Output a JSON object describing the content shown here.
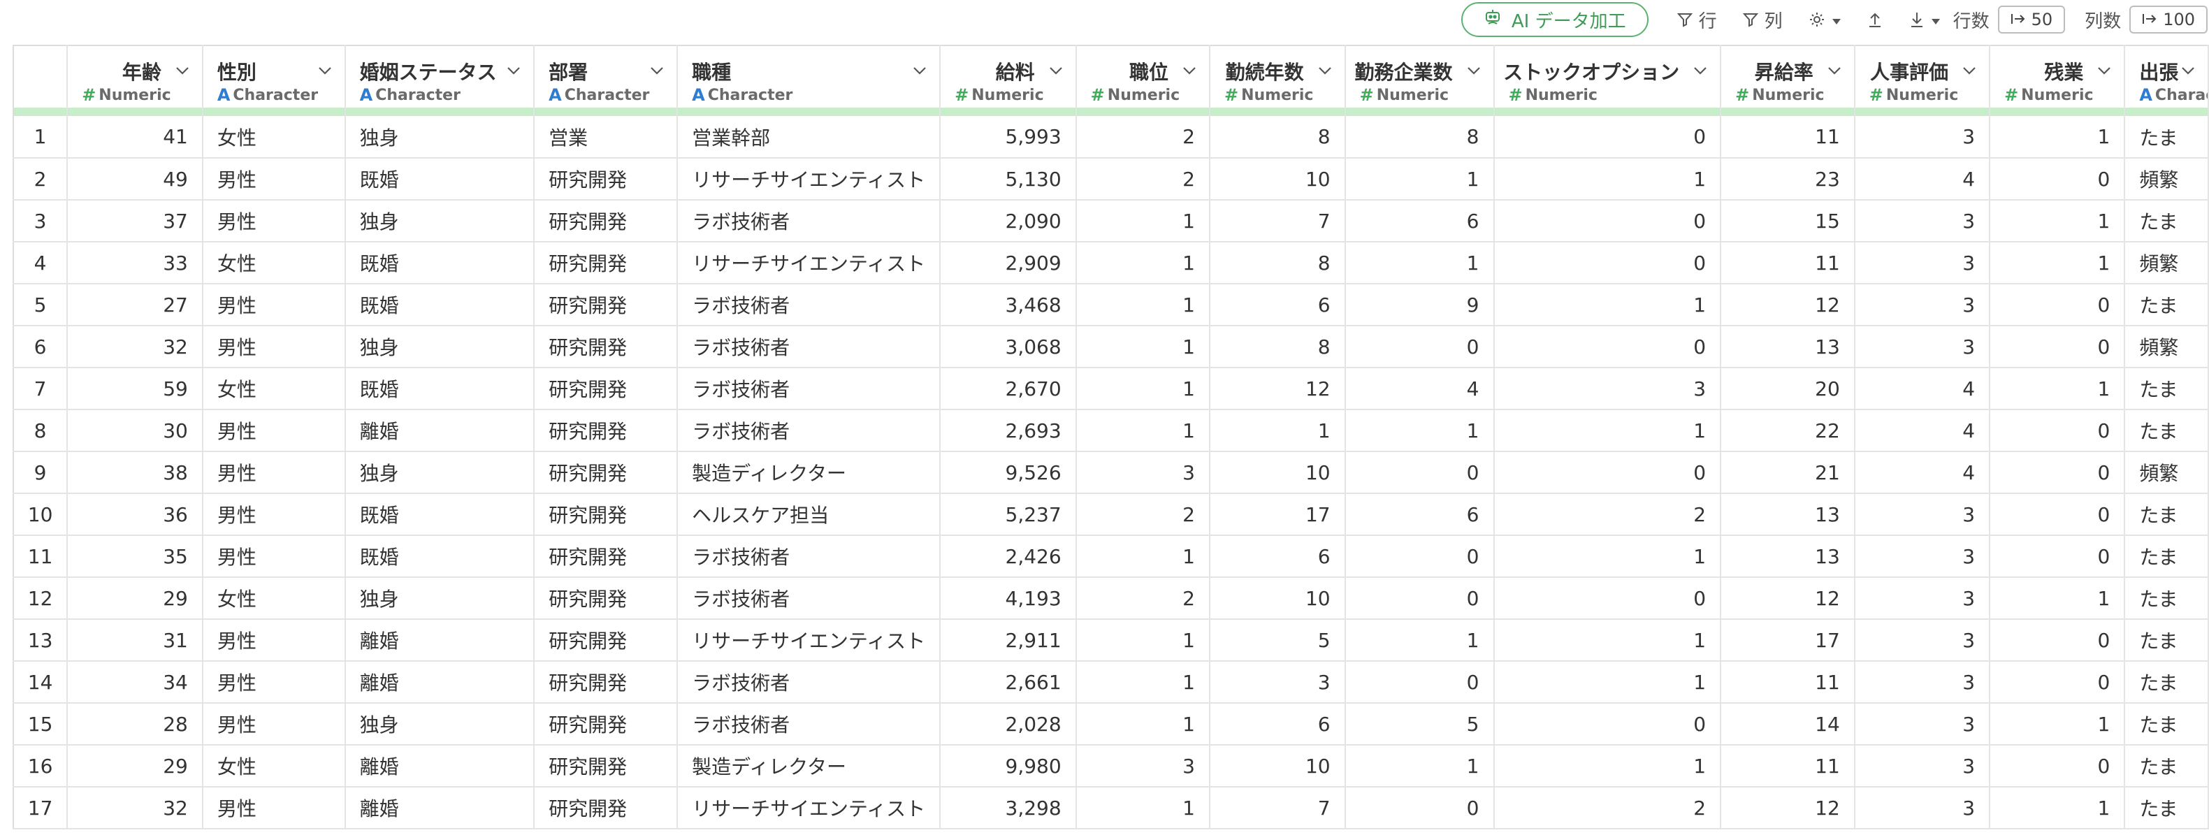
{
  "toolbar": {
    "ai_label": "AI データ加工",
    "row_filter_label": "行",
    "col_filter_label": "列",
    "rows_label": "行数",
    "rows_value": "50",
    "cols_label": "列数",
    "cols_value": "100"
  },
  "columns": [
    {
      "name": "年齢",
      "type": "Numeric",
      "align": "n"
    },
    {
      "name": "性別",
      "type": "Character",
      "align": "c"
    },
    {
      "name": "婚姻ステータス",
      "type": "Character",
      "align": "c"
    },
    {
      "name": "部署",
      "type": "Character",
      "align": "c"
    },
    {
      "name": "職種",
      "type": "Character",
      "align": "c"
    },
    {
      "name": "給料",
      "type": "Numeric",
      "align": "n"
    },
    {
      "name": "職位",
      "type": "Numeric",
      "align": "n"
    },
    {
      "name": "勤続年数",
      "type": "Numeric",
      "align": "n"
    },
    {
      "name": "勤務企業数",
      "type": "Numeric",
      "align": "n"
    },
    {
      "name": "ストックオプション",
      "type": "Numeric",
      "align": "n"
    },
    {
      "name": "昇給率",
      "type": "Numeric",
      "align": "n"
    },
    {
      "name": "人事評価",
      "type": "Numeric",
      "align": "n"
    },
    {
      "name": "残業",
      "type": "Numeric",
      "align": "n"
    },
    {
      "name": "出張",
      "type": "Character",
      "align": "c"
    }
  ],
  "rows": [
    [
      "1",
      "41",
      "女性",
      "独身",
      "営業",
      "営業幹部",
      "5,993",
      "2",
      "8",
      "8",
      "0",
      "11",
      "3",
      "1",
      "たま"
    ],
    [
      "2",
      "49",
      "男性",
      "既婚",
      "研究開発",
      "リサーチサイエンティスト",
      "5,130",
      "2",
      "10",
      "1",
      "1",
      "23",
      "4",
      "0",
      "頻繁"
    ],
    [
      "3",
      "37",
      "男性",
      "独身",
      "研究開発",
      "ラボ技術者",
      "2,090",
      "1",
      "7",
      "6",
      "0",
      "15",
      "3",
      "1",
      "たま"
    ],
    [
      "4",
      "33",
      "女性",
      "既婚",
      "研究開発",
      "リサーチサイエンティスト",
      "2,909",
      "1",
      "8",
      "1",
      "0",
      "11",
      "3",
      "1",
      "頻繁"
    ],
    [
      "5",
      "27",
      "男性",
      "既婚",
      "研究開発",
      "ラボ技術者",
      "3,468",
      "1",
      "6",
      "9",
      "1",
      "12",
      "3",
      "0",
      "たま"
    ],
    [
      "6",
      "32",
      "男性",
      "独身",
      "研究開発",
      "ラボ技術者",
      "3,068",
      "1",
      "8",
      "0",
      "0",
      "13",
      "3",
      "0",
      "頻繁"
    ],
    [
      "7",
      "59",
      "女性",
      "既婚",
      "研究開発",
      "ラボ技術者",
      "2,670",
      "1",
      "12",
      "4",
      "3",
      "20",
      "4",
      "1",
      "たま"
    ],
    [
      "8",
      "30",
      "男性",
      "離婚",
      "研究開発",
      "ラボ技術者",
      "2,693",
      "1",
      "1",
      "1",
      "1",
      "22",
      "4",
      "0",
      "たま"
    ],
    [
      "9",
      "38",
      "男性",
      "独身",
      "研究開発",
      "製造ディレクター",
      "9,526",
      "3",
      "10",
      "0",
      "0",
      "21",
      "4",
      "0",
      "頻繁"
    ],
    [
      "10",
      "36",
      "男性",
      "既婚",
      "研究開発",
      "ヘルスケア担当",
      "5,237",
      "2",
      "17",
      "6",
      "2",
      "13",
      "3",
      "0",
      "たま"
    ],
    [
      "11",
      "35",
      "男性",
      "既婚",
      "研究開発",
      "ラボ技術者",
      "2,426",
      "1",
      "6",
      "0",
      "1",
      "13",
      "3",
      "0",
      "たま"
    ],
    [
      "12",
      "29",
      "女性",
      "独身",
      "研究開発",
      "ラボ技術者",
      "4,193",
      "2",
      "10",
      "0",
      "0",
      "12",
      "3",
      "1",
      "たま"
    ],
    [
      "13",
      "31",
      "男性",
      "離婚",
      "研究開発",
      "リサーチサイエンティスト",
      "2,911",
      "1",
      "5",
      "1",
      "1",
      "17",
      "3",
      "0",
      "たま"
    ],
    [
      "14",
      "34",
      "男性",
      "離婚",
      "研究開発",
      "ラボ技術者",
      "2,661",
      "1",
      "3",
      "0",
      "1",
      "11",
      "3",
      "0",
      "たま"
    ],
    [
      "15",
      "28",
      "男性",
      "独身",
      "研究開発",
      "ラボ技術者",
      "2,028",
      "1",
      "6",
      "5",
      "0",
      "14",
      "3",
      "1",
      "たま"
    ],
    [
      "16",
      "29",
      "女性",
      "離婚",
      "研究開発",
      "製造ディレクター",
      "9,980",
      "3",
      "10",
      "1",
      "1",
      "11",
      "3",
      "0",
      "たま"
    ],
    [
      "17",
      "32",
      "男性",
      "離婚",
      "研究開発",
      "リサーチサイエンティスト",
      "3,298",
      "1",
      "7",
      "0",
      "2",
      "12",
      "3",
      "1",
      "たま"
    ]
  ],
  "colors": {
    "accent_green": "#59b36e",
    "numeric_icon": "#3fae5b",
    "character_icon": "#2f7dd1",
    "quality_bar": "#c9edcb"
  }
}
